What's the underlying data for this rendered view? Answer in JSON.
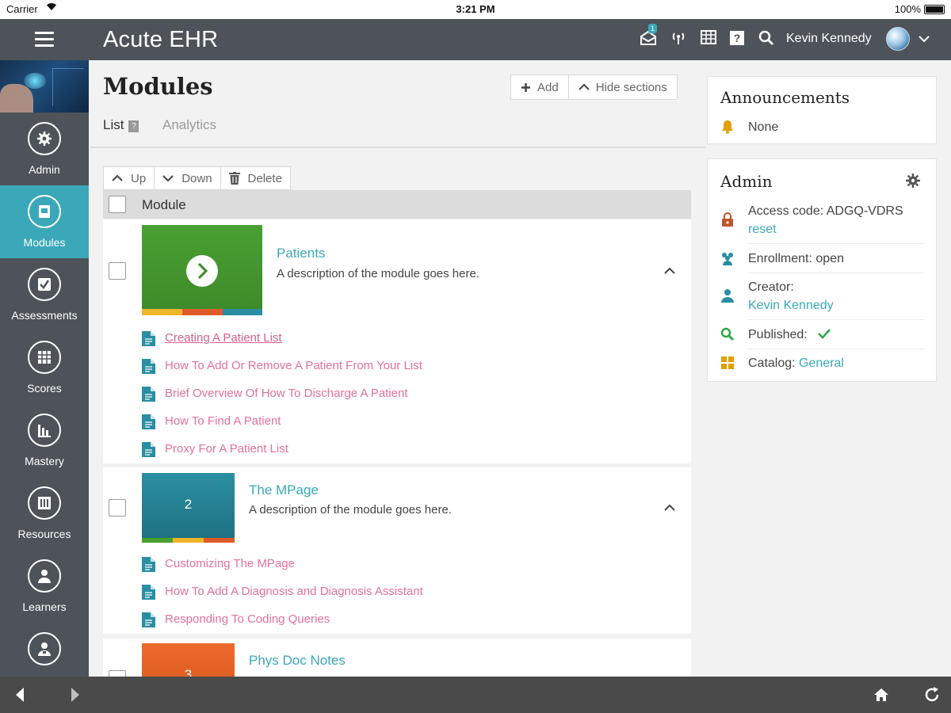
{
  "status_bar": {
    "carrier": "Carrier",
    "time": "3:21 PM",
    "battery": "100%"
  },
  "app": {
    "title": "Acute EHR",
    "user_name": "Kevin Kennedy",
    "notification_count": "1"
  },
  "sidebar": {
    "items": [
      {
        "label": "Admin",
        "icon": "gear-icon",
        "active": false
      },
      {
        "label": "Modules",
        "icon": "module-icon",
        "active": true
      },
      {
        "label": "Assessments",
        "icon": "checkbox-icon",
        "active": false
      },
      {
        "label": "Scores",
        "icon": "gradebook-icon",
        "active": false
      },
      {
        "label": "Mastery",
        "icon": "bar-chart-icon",
        "active": false
      },
      {
        "label": "Resources",
        "icon": "library-icon",
        "active": false
      },
      {
        "label": "Learners",
        "icon": "person-icon",
        "active": false
      }
    ]
  },
  "main": {
    "title": "Modules",
    "add_label": "Add",
    "hide_sections_label": "Hide sections",
    "tabs": [
      {
        "label": "List"
      },
      {
        "label": "Analytics"
      }
    ],
    "toolbar": {
      "up_label": "Up",
      "down_label": "Down",
      "delete_label": "Delete"
    },
    "column_header": "Module",
    "modules": [
      {
        "title": "Patients",
        "description": "A description of the module goes here.",
        "lessons": [
          "Creating A Patient List",
          "How To Add Or Remove A Patient From Your List",
          "Brief Overview Of How To Discharge A Patient",
          "How To Find A Patient",
          "Proxy For A Patient List"
        ]
      },
      {
        "title": "The MPage",
        "thumb_number": "2",
        "description": "A description of the module goes here.",
        "lessons": [
          "Customizing The MPage",
          "How To Add A Diagnosis and Diagnosis Assistant",
          "Responding To Coding Queries"
        ]
      },
      {
        "title": "Phys Doc Notes",
        "thumb_number": "3"
      }
    ]
  },
  "announcements": {
    "title": "Announcements",
    "value": "None"
  },
  "admin_card": {
    "title": "Admin",
    "access_code": "Access code: ADGQ-VDRS",
    "reset_label": "reset",
    "enrollment": "Enrollment: open",
    "creator_label": "Creator:",
    "creator_name": "Kevin Kennedy",
    "published_label": "Published:",
    "catalog_label": "Catalog:",
    "catalog_value": "General"
  },
  "colors": {
    "accent": "#3aa8b8",
    "chrome": "#4d5359",
    "lesson_link": "#e4709c",
    "check_green": "#2ea84a"
  }
}
